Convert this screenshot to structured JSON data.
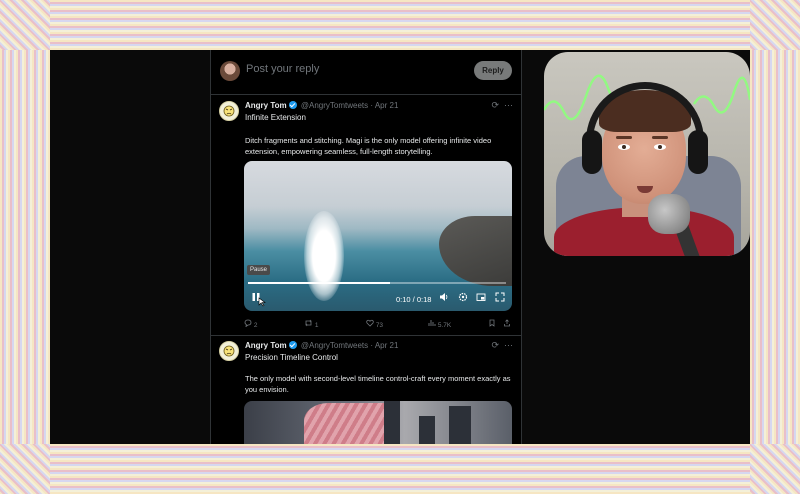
{
  "reply_bar": {
    "placeholder": "Post your reply",
    "button": "Reply"
  },
  "tweets": [
    {
      "name": "Angry Tom",
      "handle": "@AngryTomtweets",
      "date": "· Apr 21",
      "subtitle": "Infinite Extension",
      "body": "Ditch fragments and stitching. Magi is the only model offering infinite video extension, empowering seamless, full-length storytelling.",
      "video": {
        "tooltip": "Pause",
        "time": "0:10 / 0:18",
        "progress": 0.55
      },
      "actions": {
        "replies": "2",
        "reposts": "1",
        "likes": "73",
        "views": "5.7K"
      }
    },
    {
      "name": "Angry Tom",
      "handle": "@AngryTomtweets",
      "date": "· Apr 21",
      "subtitle": "Precision Timeline Control",
      "body": "The only model with second-level timeline control-craft every moment exactly as you envision."
    }
  ],
  "colors": {
    "accent": "#1d9bf0",
    "background": "#000000",
    "neon": "#7cff6b"
  }
}
